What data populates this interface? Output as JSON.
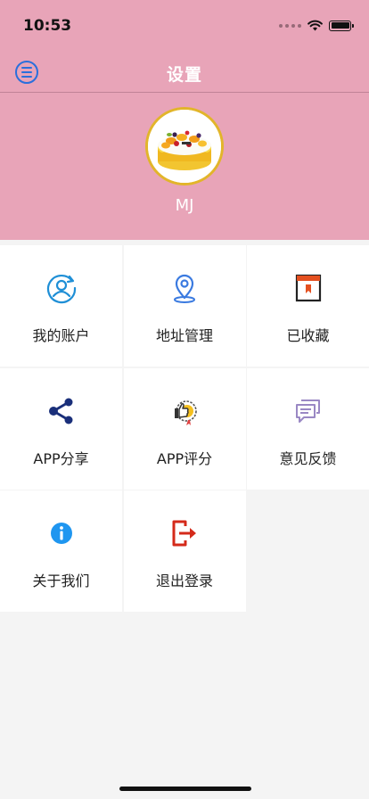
{
  "status_bar": {
    "time": "10:53"
  },
  "nav": {
    "title": "设置",
    "menu_icon": "menu-icon"
  },
  "profile": {
    "name": "MJ",
    "avatar": "cake-avatar"
  },
  "colors": {
    "header": "#e8a4b8",
    "accent": "#2a6fdc"
  },
  "menu_items": [
    {
      "label": "我的账户",
      "icon": "account-icon"
    },
    {
      "label": "地址管理",
      "icon": "location-pin-icon"
    },
    {
      "label": "已收藏",
      "icon": "bookmark-icon"
    },
    {
      "label": "APP分享",
      "icon": "share-icon"
    },
    {
      "label": "APP评分",
      "icon": "thumbs-up-badge-icon"
    },
    {
      "label": "意见反馈",
      "icon": "feedback-chat-icon"
    },
    {
      "label": "关于我们",
      "icon": "info-icon"
    },
    {
      "label": "退出登录",
      "icon": "logout-icon"
    }
  ]
}
